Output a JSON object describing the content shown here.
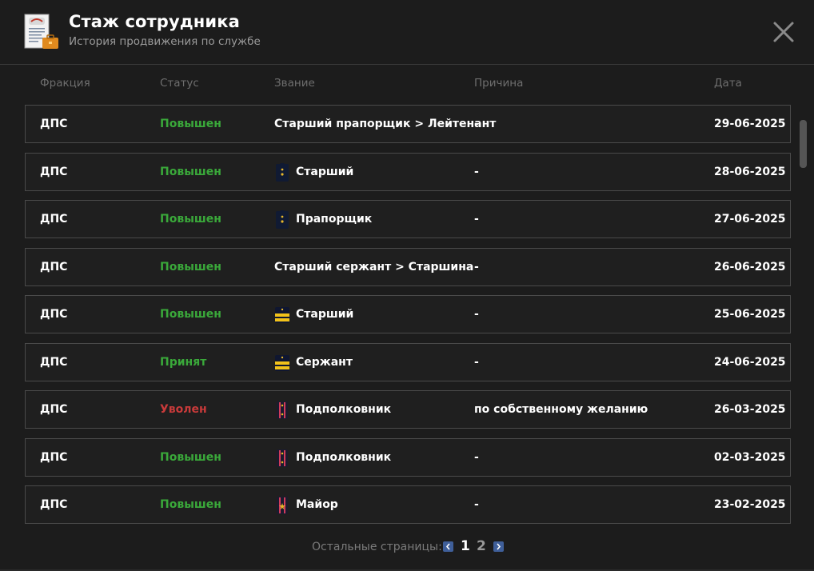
{
  "header": {
    "title": "Стаж сотрудника",
    "subtitle": "История продвижения по службе"
  },
  "columns": {
    "faction": "Фракция",
    "status": "Статус",
    "rank": "Звание",
    "reason": "Причина",
    "date": "Дата"
  },
  "rows": [
    {
      "faction": "ДПС",
      "status": "Повышен",
      "status_color": "#3aa83a",
      "rank": "Старший прапорщик > Лейтенант",
      "rank_icon": "",
      "reason": "-",
      "date": "29-06-2025"
    },
    {
      "faction": "ДПС",
      "status": "Повышен",
      "status_color": "#3aa83a",
      "rank": "Старший",
      "rank_icon": "navy-epaulet-star-icon",
      "reason": "-",
      "date": "28-06-2025"
    },
    {
      "faction": "ДПС",
      "status": "Повышен",
      "status_color": "#3aa83a",
      "rank": "Прапорщик",
      "rank_icon": "navy-epaulet-star-icon",
      "reason": "-",
      "date": "27-06-2025"
    },
    {
      "faction": "ДПС",
      "status": "Повышен",
      "status_color": "#3aa83a",
      "rank": "Старший сержант > Старшина",
      "rank_icon": "",
      "reason": "-",
      "date": "26-06-2025"
    },
    {
      "faction": "ДПС",
      "status": "Повышен",
      "status_color": "#3aa83a",
      "rank": "Старший",
      "rank_icon": "gold-stripes-epaulet-icon",
      "reason": "-",
      "date": "25-06-2025"
    },
    {
      "faction": "ДПС",
      "status": "Принят",
      "status_color": "#3aa83a",
      "rank": "Сержант",
      "rank_icon": "gold-stripes-epaulet-icon",
      "reason": "-",
      "date": "24-06-2025"
    },
    {
      "faction": "ДПС",
      "status": "Уволен",
      "status_color": "#c83a3a",
      "rank": "Подполковник",
      "rank_icon": "red-double-stripe-epaulet-icon",
      "reason": "по собственному желанию",
      "date": "26-03-2025"
    },
    {
      "faction": "ДПС",
      "status": "Повышен",
      "status_color": "#3aa83a",
      "rank": "Подполковник",
      "rank_icon": "red-double-stripe-epaulet-icon",
      "reason": "-",
      "date": "02-03-2025"
    },
    {
      "faction": "ДПС",
      "status": "Повышен",
      "status_color": "#3aa83a",
      "rank": "Майор",
      "rank_icon": "red-double-stripe-star-epaulet-icon",
      "reason": "-",
      "date": "23-02-2025"
    }
  ],
  "pagination": {
    "label": "Остальные страницы:",
    "pages": [
      "1",
      "2"
    ],
    "current": "1"
  }
}
